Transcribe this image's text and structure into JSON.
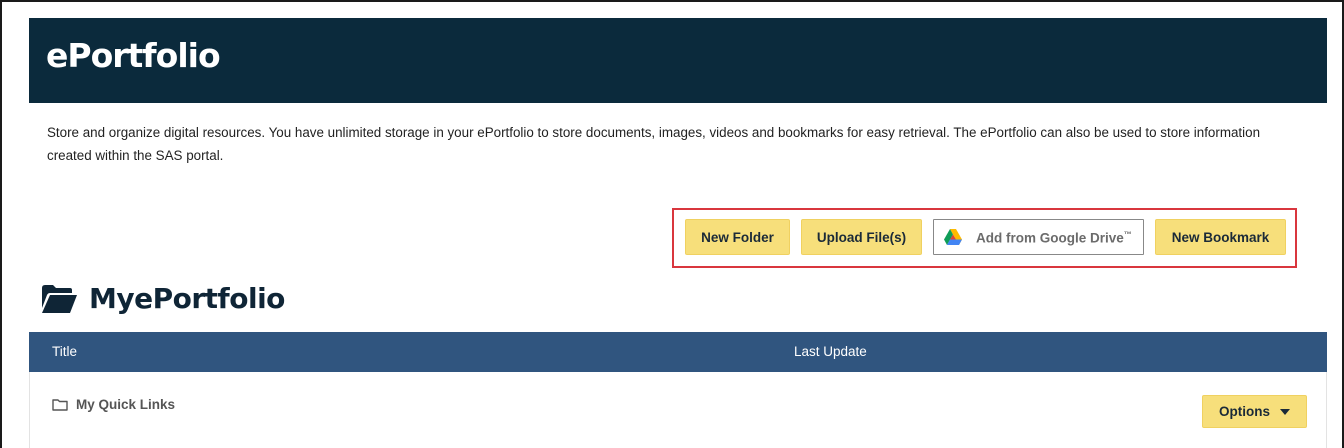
{
  "header": {
    "title": "ePortfolio"
  },
  "description": "Store and organize digital resources. You have unlimited storage in your ePortfolio to store documents, images, videos and bookmarks for easy retrieval. The ePortfolio can also be used to store information created within the SAS portal.",
  "toolbar": {
    "new_folder_label": "New Folder",
    "upload_label": "Upload File(s)",
    "gdrive_label": "Add from Google Drive",
    "gdrive_tm": "™",
    "new_bookmark_label": "New Bookmark"
  },
  "section": {
    "title": "MyePortfolio"
  },
  "table": {
    "columns": [
      "Title",
      "Last Update"
    ],
    "rows": [
      {
        "title": "My Quick Links",
        "last_update": "",
        "options_label": "Options"
      }
    ]
  },
  "colors": {
    "header_bg": "#0b2a3c",
    "button_bg": "#f7df7b",
    "table_header_bg": "#30557f",
    "highlight": "#d9363e"
  },
  "icons": {
    "gdrive": "google-drive-icon",
    "section": "folder-open-icon",
    "row": "folder-icon",
    "options": "caret-down-icon"
  }
}
